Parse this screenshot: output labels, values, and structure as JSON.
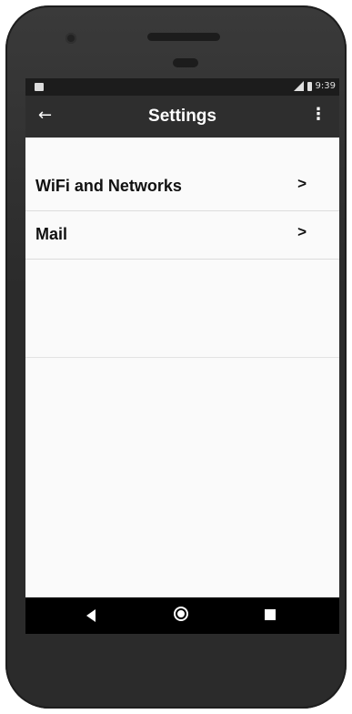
{
  "status_bar": {
    "time": "9:39",
    "left_icon": "image-notification-icon",
    "signal_icon": "signal-lte-icon",
    "battery_icon": "battery-icon"
  },
  "toolbar": {
    "title": "Settings",
    "back_icon": "←",
    "menu_icon": "⋮"
  },
  "settings_list": [
    {
      "label": "WiFi and Networks",
      "arrow": ">"
    },
    {
      "label": "Mail",
      "arrow": ">"
    }
  ],
  "nav_bar": {
    "back": "back-triangle-icon",
    "home": "home-circle-icon",
    "recents": "recents-square-icon"
  }
}
